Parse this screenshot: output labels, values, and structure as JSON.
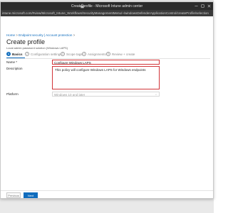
{
  "window": {
    "title": "Create profile - Microsoft Intune admin center",
    "url": "intune.microsoft.com/#view/Microsoft_Intune_Workflows/SecurityManagementMenu/~/windowsDefenderApplicationControl/createProfile/selection"
  },
  "breadcrumb": [
    "Home",
    "Endpoint security | Account protection"
  ],
  "page": {
    "title": "Create profile",
    "subtitle": "Local admin password solution (Windows LAPS)"
  },
  "tabs": [
    {
      "num": "1",
      "label": "Basics"
    },
    {
      "num": "2",
      "label": "Configuration settings"
    },
    {
      "num": "3",
      "label": "Scope tags"
    },
    {
      "num": "4",
      "label": "Assignments"
    },
    {
      "num": "5",
      "label": "Review + create"
    }
  ],
  "form": {
    "name_label": "Name *",
    "name_value": "Configure Windows LAPS",
    "description_label": "Description",
    "description_value": "This policy will configure Windows LAPS for Windows endpoints",
    "platform_label": "Platform",
    "platform_value": "Windows 10 and later"
  },
  "footer": {
    "previous": "Previous",
    "next": "Next"
  },
  "colors": {
    "accent": "#0f6cbd",
    "error_border": "#d13438",
    "titlebar": "#2b2b2b"
  }
}
